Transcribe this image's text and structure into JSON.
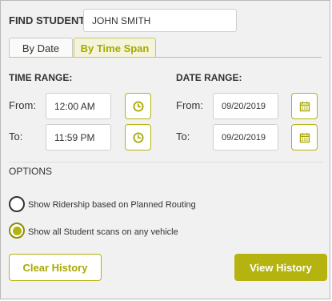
{
  "find": {
    "label": "FIND STUDENT",
    "value": "JOHN SMITH"
  },
  "tabs": [
    {
      "label": "By Date",
      "active": false
    },
    {
      "label": "By Time Span",
      "active": true
    }
  ],
  "time_range": {
    "title": "TIME RANGE:",
    "from_label": "From:",
    "from_value": "12:00 AM",
    "to_label": "To:",
    "to_value": "11:59 PM",
    "icon": "clock-icon"
  },
  "date_range": {
    "title": "DATE RANGE:",
    "from_label": "From:",
    "from_value": "09/20/2019",
    "to_label": "To:",
    "to_value": "09/20/2019",
    "icon": "calendar-icon"
  },
  "options": {
    "title": "OPTIONS",
    "items": [
      {
        "label": "Show Ridership based on Planned Routing",
        "selected": false
      },
      {
        "label": "Show all Student scans on any vehicle",
        "selected": true
      }
    ]
  },
  "buttons": {
    "clear": "Clear History",
    "view": "View History"
  },
  "colors": {
    "accent": "#b5b30f",
    "accent_text": "#a7a900",
    "background": "#f1f1f1"
  }
}
